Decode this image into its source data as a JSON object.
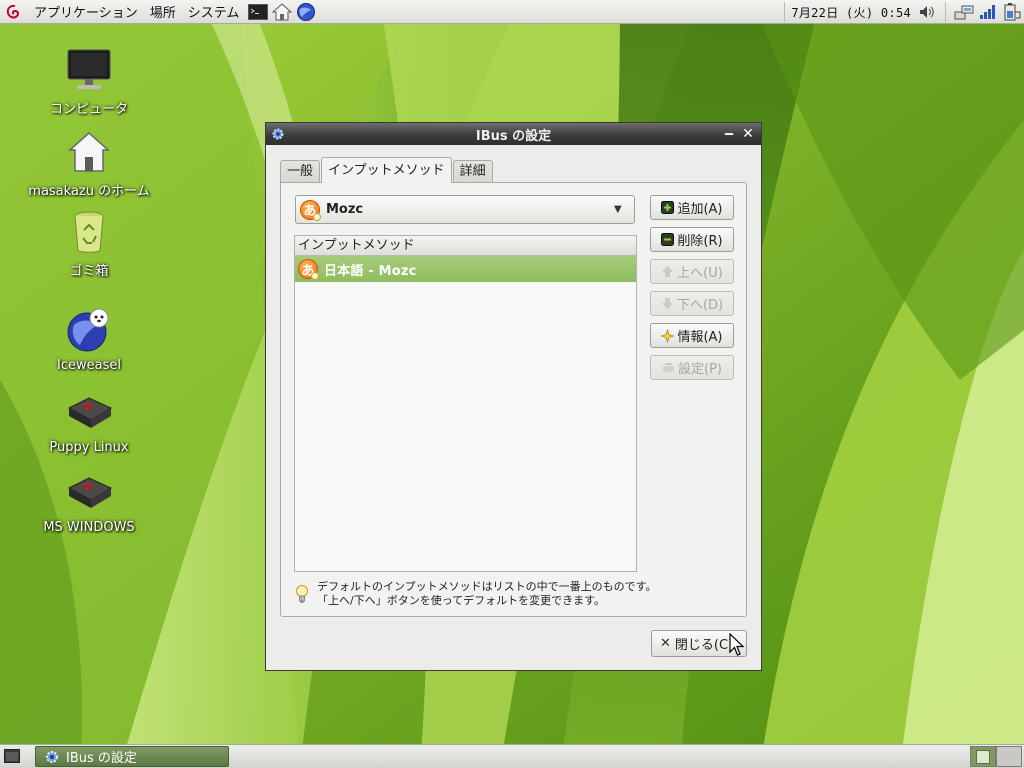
{
  "top_panel": {
    "menus": [
      "アプリケーション",
      "場所",
      "システム"
    ],
    "clock": "7月22日 (火)  0:54"
  },
  "desktop_icons": [
    {
      "label": "コンピュータ",
      "icon": "computer-icon"
    },
    {
      "label": "masakazu のホーム",
      "icon": "home-folder-icon"
    },
    {
      "label": "ゴミ箱",
      "icon": "trash-icon"
    },
    {
      "label": "Iceweasel",
      "icon": "iceweasel-icon"
    },
    {
      "label": "Puppy Linux",
      "icon": "hard-drive-icon"
    },
    {
      "label": "MS WINDOWS",
      "icon": "hard-drive-icon"
    }
  ],
  "window": {
    "title": "IBus の設定",
    "tabs": [
      "一般",
      "インプットメソッド",
      "詳細"
    ],
    "active_tab": "インプットメソッド",
    "combo": {
      "ime_glyph": "あ",
      "selected": "Mozc"
    },
    "list": {
      "header": "インプットメソッド",
      "rows": [
        {
          "ime_glyph": "あ",
          "text": "日本語  -  Mozc",
          "selected": true
        }
      ]
    },
    "buttons": {
      "add": "追加(A)",
      "remove": "削除(R)",
      "up": "上へ(U)",
      "down": "下へ(D)",
      "info": "情報(A)",
      "settings": "設定(P)"
    },
    "hint_line1": "デフォルトのインプットメソッドはリストの中で一番上のものです。",
    "hint_line2": "「上へ/下へ」ボタンを使ってデフォルトを変更できます。",
    "close_label": "閉じる(C)"
  },
  "taskbar": {
    "task_title": "IBus の設定"
  },
  "colors": {
    "selection": "#96c166",
    "wallpaper": "#6fa318",
    "taskbar_active": "#6c8a52"
  }
}
